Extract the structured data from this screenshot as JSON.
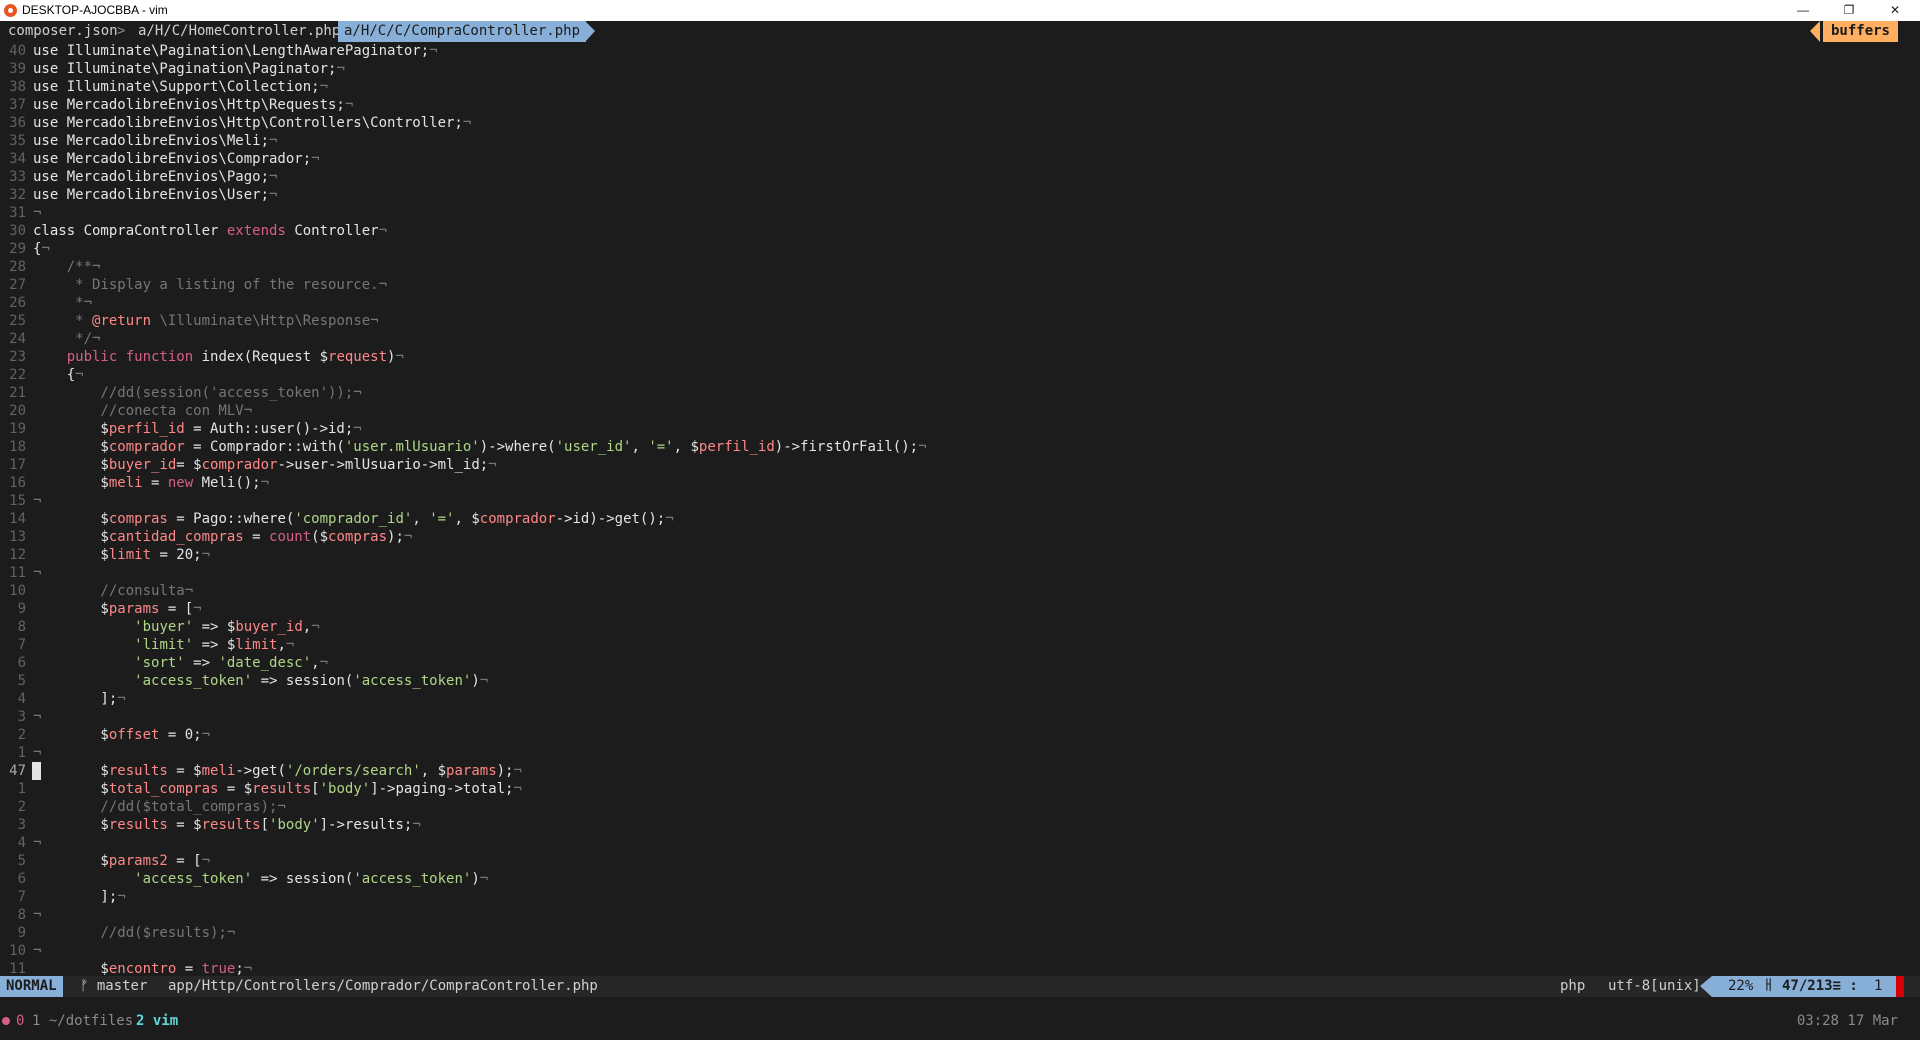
{
  "window": {
    "title": "DESKTOP-AJOCBBA - vim",
    "minimize": "—",
    "restore": "❐",
    "close": "✕"
  },
  "tabline": {
    "tabs": [
      "composer.json",
      "a/H/C/HomeController.php",
      "a/H/C/C/CompraController.php"
    ],
    "separator": ">",
    "buffers": "buffers"
  },
  "editor": {
    "lines": [
      {
        "n": "40",
        "t": [
          [
            "",
            "use Illuminate\\Pagination\\LengthAwarePaginator;"
          ],
          [
            "c-com",
            "¬"
          ]
        ]
      },
      {
        "n": "39",
        "t": [
          [
            "",
            "use Illuminate\\Pagination\\Paginator;"
          ],
          [
            "c-com",
            "¬"
          ]
        ]
      },
      {
        "n": "38",
        "t": [
          [
            "",
            "use Illuminate\\Support\\Collection;"
          ],
          [
            "c-com",
            "¬"
          ]
        ]
      },
      {
        "n": "37",
        "t": [
          [
            "",
            "use MercadolibreEnvios\\Http\\Requests;"
          ],
          [
            "c-com",
            "¬"
          ]
        ]
      },
      {
        "n": "36",
        "t": [
          [
            "",
            "use MercadolibreEnvios\\Http\\Controllers\\Controller;"
          ],
          [
            "c-com",
            "¬"
          ]
        ]
      },
      {
        "n": "35",
        "t": [
          [
            "",
            "use MercadolibreEnvios\\Meli;"
          ],
          [
            "c-com",
            "¬"
          ]
        ]
      },
      {
        "n": "34",
        "t": [
          [
            "",
            "use MercadolibreEnvios\\Comprador;"
          ],
          [
            "c-com",
            "¬"
          ]
        ]
      },
      {
        "n": "33",
        "t": [
          [
            "",
            "use MercadolibreEnvios\\Pago;"
          ],
          [
            "c-com",
            "¬"
          ]
        ]
      },
      {
        "n": "32",
        "t": [
          [
            "",
            "use MercadolibreEnvios\\User;"
          ],
          [
            "c-com",
            "¬"
          ]
        ]
      },
      {
        "n": "31",
        "t": [
          [
            "c-com",
            "¬"
          ]
        ]
      },
      {
        "n": "30",
        "t": [
          [
            "",
            "class CompraController "
          ],
          [
            "c-kw",
            "extends"
          ],
          [
            "",
            " Controller"
          ],
          [
            "c-com",
            "¬"
          ]
        ]
      },
      {
        "n": "29",
        "t": [
          [
            "",
            "{"
          ],
          [
            "c-com",
            "¬"
          ]
        ]
      },
      {
        "n": "28",
        "t": [
          [
            "c-com",
            "    /**¬"
          ]
        ]
      },
      {
        "n": "27",
        "t": [
          [
            "c-com",
            "     * Display a listing of the resource.¬"
          ]
        ]
      },
      {
        "n": "26",
        "t": [
          [
            "c-com",
            "     *¬"
          ]
        ]
      },
      {
        "n": "25",
        "t": [
          [
            "c-com",
            "     * "
          ],
          [
            "c-var",
            "@return"
          ],
          [
            "c-com",
            " \\Illuminate\\Http\\Response¬"
          ]
        ]
      },
      {
        "n": "24",
        "t": [
          [
            "c-com",
            "     */¬"
          ]
        ]
      },
      {
        "n": "23",
        "t": [
          [
            "",
            "    "
          ],
          [
            "c-kw",
            "public function"
          ],
          [
            "",
            " index(Request $"
          ],
          [
            "c-var",
            "request"
          ],
          [
            "",
            ")"
          ],
          [
            "c-com",
            "¬"
          ]
        ]
      },
      {
        "n": "22",
        "t": [
          [
            "",
            "    {"
          ],
          [
            "c-com",
            "¬"
          ]
        ]
      },
      {
        "n": "21",
        "t": [
          [
            "c-com",
            "        //dd(session('access_token'));¬"
          ]
        ]
      },
      {
        "n": "20",
        "t": [
          [
            "c-com",
            "        //conecta con MLV¬"
          ]
        ]
      },
      {
        "n": "19",
        "t": [
          [
            "",
            "        $"
          ],
          [
            "c-var",
            "perfil_id"
          ],
          [
            "",
            " = Auth::user()->id;"
          ],
          [
            "c-com",
            "¬"
          ]
        ]
      },
      {
        "n": "18",
        "t": [
          [
            "",
            "        $"
          ],
          [
            "c-var",
            "comprador"
          ],
          [
            "",
            " = Comprador::with("
          ],
          [
            "c-str",
            "'user.mlUsuario'"
          ],
          [
            "",
            ")->where("
          ],
          [
            "c-str",
            "'user_id'"
          ],
          [
            "",
            ", "
          ],
          [
            "c-str",
            "'='"
          ],
          [
            "",
            ", $"
          ],
          [
            "c-var",
            "perfil_id"
          ],
          [
            "",
            ")->firstOrFail();"
          ],
          [
            "c-com",
            "¬"
          ]
        ]
      },
      {
        "n": "17",
        "t": [
          [
            "",
            "        $"
          ],
          [
            "c-var",
            "buyer_id"
          ],
          [
            "",
            "= $"
          ],
          [
            "c-var",
            "comprador"
          ],
          [
            "",
            "->user->mlUsuario->ml_id;"
          ],
          [
            "c-com",
            "¬"
          ]
        ]
      },
      {
        "n": "16",
        "t": [
          [
            "",
            "        $"
          ],
          [
            "c-var",
            "meli"
          ],
          [
            "",
            " = "
          ],
          [
            "c-kw",
            "new"
          ],
          [
            "",
            " Meli();"
          ],
          [
            "c-com",
            "¬"
          ]
        ]
      },
      {
        "n": "15",
        "t": [
          [
            "c-com",
            "¬"
          ]
        ]
      },
      {
        "n": "14",
        "t": [
          [
            "",
            "        $"
          ],
          [
            "c-var",
            "compras"
          ],
          [
            "",
            " = Pago::where("
          ],
          [
            "c-str",
            "'comprador_id'"
          ],
          [
            "",
            ", "
          ],
          [
            "c-str",
            "'='"
          ],
          [
            "",
            ", $"
          ],
          [
            "c-var",
            "comprador"
          ],
          [
            "",
            "->id)->get();"
          ],
          [
            "c-com",
            "¬"
          ]
        ]
      },
      {
        "n": "13",
        "t": [
          [
            "",
            "        $"
          ],
          [
            "c-var",
            "cantidad_compras"
          ],
          [
            "",
            " = "
          ],
          [
            "c-kw",
            "count"
          ],
          [
            "",
            "($"
          ],
          [
            "c-var",
            "compras"
          ],
          [
            "",
            ");"
          ],
          [
            "c-com",
            "¬"
          ]
        ]
      },
      {
        "n": "12",
        "t": [
          [
            "",
            "        $"
          ],
          [
            "c-var",
            "limit"
          ],
          [
            "",
            " = 20;"
          ],
          [
            "c-com",
            "¬"
          ]
        ]
      },
      {
        "n": "11",
        "t": [
          [
            "c-com",
            "¬"
          ]
        ]
      },
      {
        "n": "10",
        "t": [
          [
            "c-com",
            "        //consulta¬"
          ]
        ]
      },
      {
        "n": "9",
        "t": [
          [
            "",
            "        $"
          ],
          [
            "c-var",
            "params"
          ],
          [
            "",
            " = ["
          ],
          [
            "c-com",
            "¬"
          ]
        ]
      },
      {
        "n": "8",
        "t": [
          [
            "",
            "            "
          ],
          [
            "c-str",
            "'buyer'"
          ],
          [
            "",
            " => $"
          ],
          [
            "c-var",
            "buyer_id"
          ],
          [
            "",
            ","
          ],
          [
            "c-com",
            "¬"
          ]
        ]
      },
      {
        "n": "7",
        "t": [
          [
            "",
            "            "
          ],
          [
            "c-str",
            "'limit'"
          ],
          [
            "",
            " => $"
          ],
          [
            "c-var",
            "limit"
          ],
          [
            "",
            ","
          ],
          [
            "c-com",
            "¬"
          ]
        ]
      },
      {
        "n": "6",
        "t": [
          [
            "",
            "            "
          ],
          [
            "c-str",
            "'sort'"
          ],
          [
            "",
            " => "
          ],
          [
            "c-str",
            "'date_desc'"
          ],
          [
            "",
            ","
          ],
          [
            "c-com",
            "¬"
          ]
        ]
      },
      {
        "n": "5",
        "t": [
          [
            "",
            "            "
          ],
          [
            "c-str",
            "'access_token'"
          ],
          [
            "",
            " => session("
          ],
          [
            "c-str",
            "'access_token'"
          ],
          [
            "",
            ")"
          ],
          [
            "c-com",
            "¬"
          ]
        ]
      },
      {
        "n": "4",
        "t": [
          [
            "",
            "        ];"
          ],
          [
            "c-com",
            "¬"
          ]
        ]
      },
      {
        "n": "3",
        "t": [
          [
            "c-com",
            "¬"
          ]
        ]
      },
      {
        "n": "2",
        "t": [
          [
            "",
            "        $"
          ],
          [
            "c-var",
            "offset"
          ],
          [
            "",
            " = 0;"
          ],
          [
            "c-com",
            "¬"
          ]
        ]
      },
      {
        "n": "1",
        "t": [
          [
            "c-com",
            "¬"
          ]
        ]
      },
      {
        "n": "47",
        "cur": true,
        "t": [
          [
            "",
            "        $"
          ],
          [
            "c-var",
            "results"
          ],
          [
            "",
            " = $"
          ],
          [
            "c-var",
            "meli"
          ],
          [
            "",
            "->get("
          ],
          [
            "c-str",
            "'/orders/search'"
          ],
          [
            "",
            ", $"
          ],
          [
            "c-var",
            "params"
          ],
          [
            "",
            ");"
          ],
          [
            "c-com",
            "¬"
          ]
        ]
      },
      {
        "n": "1",
        "t": [
          [
            "",
            "        $"
          ],
          [
            "c-var",
            "total_compras"
          ],
          [
            "",
            " = $"
          ],
          [
            "c-var",
            "results"
          ],
          [
            "",
            "["
          ],
          [
            "c-str",
            "'body'"
          ],
          [
            "",
            "]->paging->total;"
          ],
          [
            "c-com",
            "¬"
          ]
        ]
      },
      {
        "n": "2",
        "t": [
          [
            "c-com",
            "        //dd($total_compras);¬"
          ]
        ]
      },
      {
        "n": "3",
        "t": [
          [
            "",
            "        $"
          ],
          [
            "c-var",
            "results"
          ],
          [
            "",
            " = $"
          ],
          [
            "c-var",
            "results"
          ],
          [
            "",
            "["
          ],
          [
            "c-str",
            "'body'"
          ],
          [
            "",
            "]->results;"
          ],
          [
            "c-com",
            "¬"
          ]
        ]
      },
      {
        "n": "4",
        "t": [
          [
            "c-com",
            "¬"
          ]
        ]
      },
      {
        "n": "5",
        "t": [
          [
            "",
            "        $"
          ],
          [
            "c-var",
            "params2"
          ],
          [
            "",
            " = ["
          ],
          [
            "c-com",
            "¬"
          ]
        ]
      },
      {
        "n": "6",
        "t": [
          [
            "",
            "            "
          ],
          [
            "c-str",
            "'access_token'"
          ],
          [
            "",
            " => session("
          ],
          [
            "c-str",
            "'access_token'"
          ],
          [
            "",
            ")"
          ],
          [
            "c-com",
            "¬"
          ]
        ]
      },
      {
        "n": "7",
        "t": [
          [
            "",
            "        ];"
          ],
          [
            "c-com",
            "¬"
          ]
        ]
      },
      {
        "n": "8",
        "t": [
          [
            "c-com",
            "¬"
          ]
        ]
      },
      {
        "n": "9",
        "t": [
          [
            "c-com",
            "        //dd($results);¬"
          ]
        ]
      },
      {
        "n": "10",
        "t": [
          [
            "c-com",
            "¬"
          ]
        ]
      },
      {
        "n": "11",
        "t": [
          [
            "",
            "        $"
          ],
          [
            "c-var",
            "encontro"
          ],
          [
            "",
            " = "
          ],
          [
            "c-kw",
            "true"
          ],
          [
            "",
            ";"
          ],
          [
            "c-com",
            "¬"
          ]
        ]
      }
    ]
  },
  "statusline": {
    "mode": "NORMAL",
    "branch": "ᚠ master",
    "path": "app/Http/Controllers/Comprador/CompraController.php",
    "filetype": "php",
    "encoding": "utf-8[unix]",
    "percent": "22%",
    "ln_icon": "ㅐ",
    "position": "47/213≡ :",
    "column": "1"
  },
  "tmux": {
    "session": "0",
    "window1": "1 ~/dotfiles",
    "window2": "2 vim",
    "clock": "03:28  17 Mar"
  },
  "colors": {
    "background": "#1c1c1c",
    "accent": "#87afd7",
    "buffers": "#ffaf5f",
    "keyword": "#d75f87",
    "string": "#afd787",
    "variable": "#ff8787",
    "comment": "#767676"
  }
}
